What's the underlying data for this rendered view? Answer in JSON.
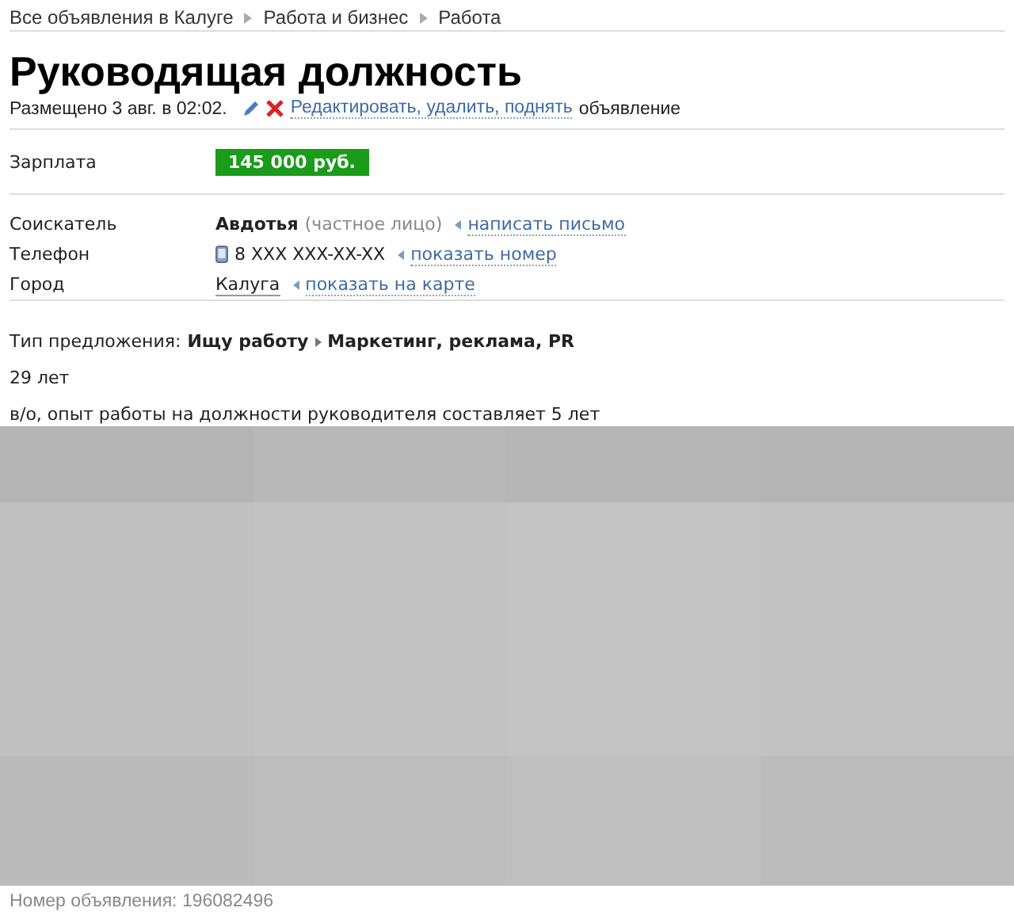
{
  "breadcrumbs": [
    "Все объявления в Калуге",
    "Работа и бизнес",
    "Работа"
  ],
  "title": "Руководящая должность",
  "meta": {
    "posted": "Размещено 3 авг. в 02:02.",
    "edit_link": "Редактировать, удалить, поднять",
    "edit_suffix": "объявление"
  },
  "salary": {
    "label": "Зарплата",
    "value": "145 000 руб."
  },
  "details": [
    {
      "kind": "person",
      "label": "Соискатель",
      "value": "Авдотья",
      "note": "(частное лицо)",
      "link": "написать письмо"
    },
    {
      "kind": "phone",
      "label": "Телефон",
      "value": "8 XXX XXX-XX-XX",
      "link": "показать номер"
    },
    {
      "kind": "city",
      "label": "Город",
      "value": "Калуга",
      "link": "показать на карте"
    }
  ],
  "offer": {
    "label": "Тип предложения:",
    "type": "Ищу работу",
    "category": "Маркетинг, реклама, PR"
  },
  "description": [
    "29 лет",
    "в/о, опыт работы на должности руководителя составляет 5 лет"
  ],
  "footer": "Номер объявления: 196082496"
}
